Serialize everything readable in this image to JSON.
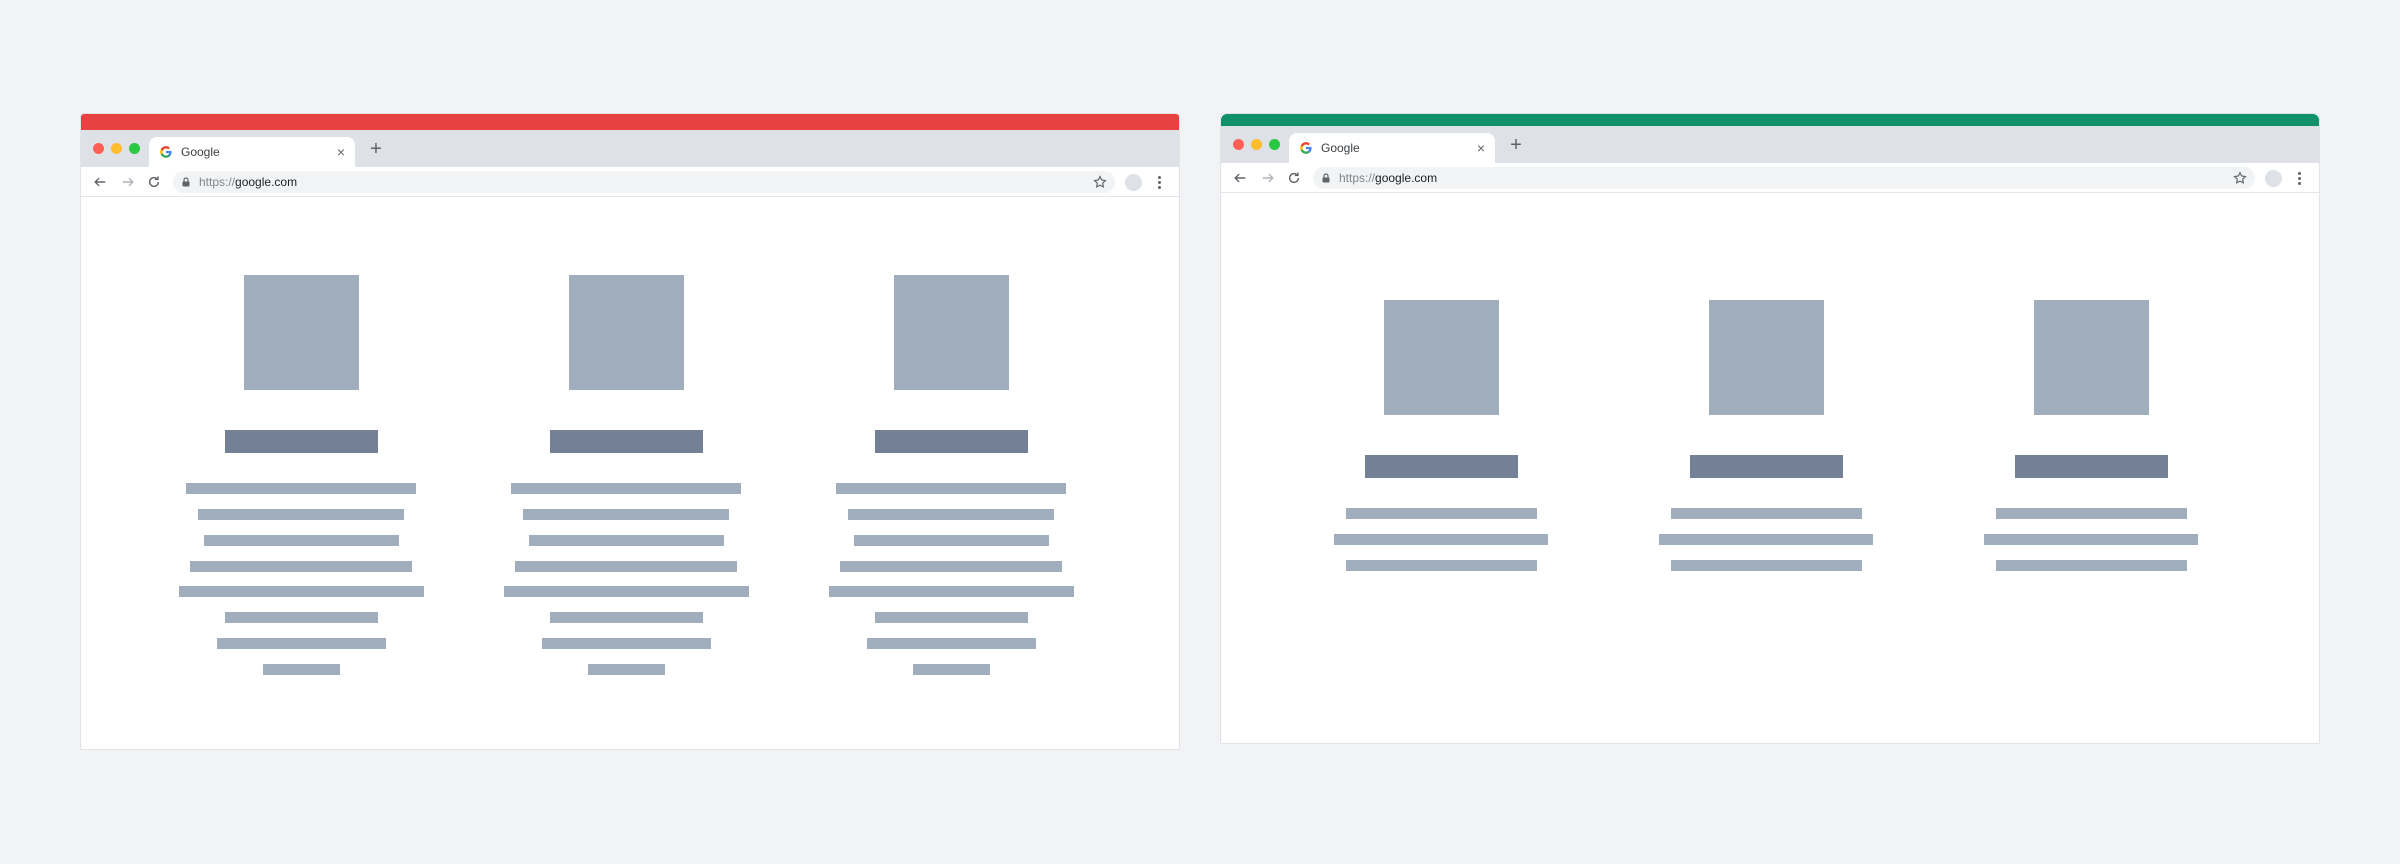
{
  "colors": {
    "left_accent": "#e84141",
    "right_accent": "#0f9168",
    "placeholder_light": "#a0adbd",
    "placeholder_dark": "#738096"
  },
  "windows": [
    {
      "id": "left",
      "tab": {
        "icon": "google-g-icon",
        "title": "Google",
        "close": "×",
        "new_tab": "+"
      },
      "address": {
        "scheme": "https://",
        "host": "google.com"
      },
      "layout_variant": "long-text"
    },
    {
      "id": "right",
      "tab": {
        "icon": "google-g-icon",
        "title": "Google",
        "close": "×",
        "new_tab": "+"
      },
      "address": {
        "scheme": "https://",
        "host": "google.com"
      },
      "layout_variant": "short-text"
    }
  ]
}
